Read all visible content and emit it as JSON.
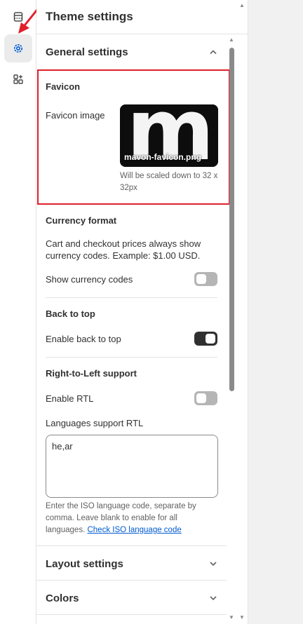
{
  "panel": {
    "title": "Theme settings"
  },
  "groups": {
    "general": {
      "label": "General settings",
      "expanded": true
    },
    "layout": {
      "label": "Layout settings"
    },
    "colors": {
      "label": "Colors"
    }
  },
  "favicon": {
    "heading": "Favicon",
    "field_label": "Favicon image",
    "file_name": "mavon-favicon.png",
    "image_letter": "m",
    "hint": "Will be scaled down to 32 x 32px"
  },
  "currency": {
    "heading": "Currency format",
    "description": "Cart and checkout prices always show currency codes. Example: $1.00 USD.",
    "toggle_label": "Show currency codes",
    "enabled": false
  },
  "back_to_top": {
    "heading": "Back to top",
    "toggle_label": "Enable back to top",
    "enabled": true
  },
  "rtl": {
    "heading": "Right-to-Left support",
    "toggle_label": "Enable RTL",
    "enabled": false,
    "languages_label": "Languages support RTL",
    "languages_value": "he,ar",
    "hint": "Enter the ISO language code, separate by comma. Leave blank to enable for all languages.",
    "link_text": "Check ISO language code"
  },
  "colors_accent": {
    "highlight": "#e01f2b",
    "link": "#005bd3",
    "toggle_on": "#303030",
    "toggle_off": "#b5b5b5"
  }
}
